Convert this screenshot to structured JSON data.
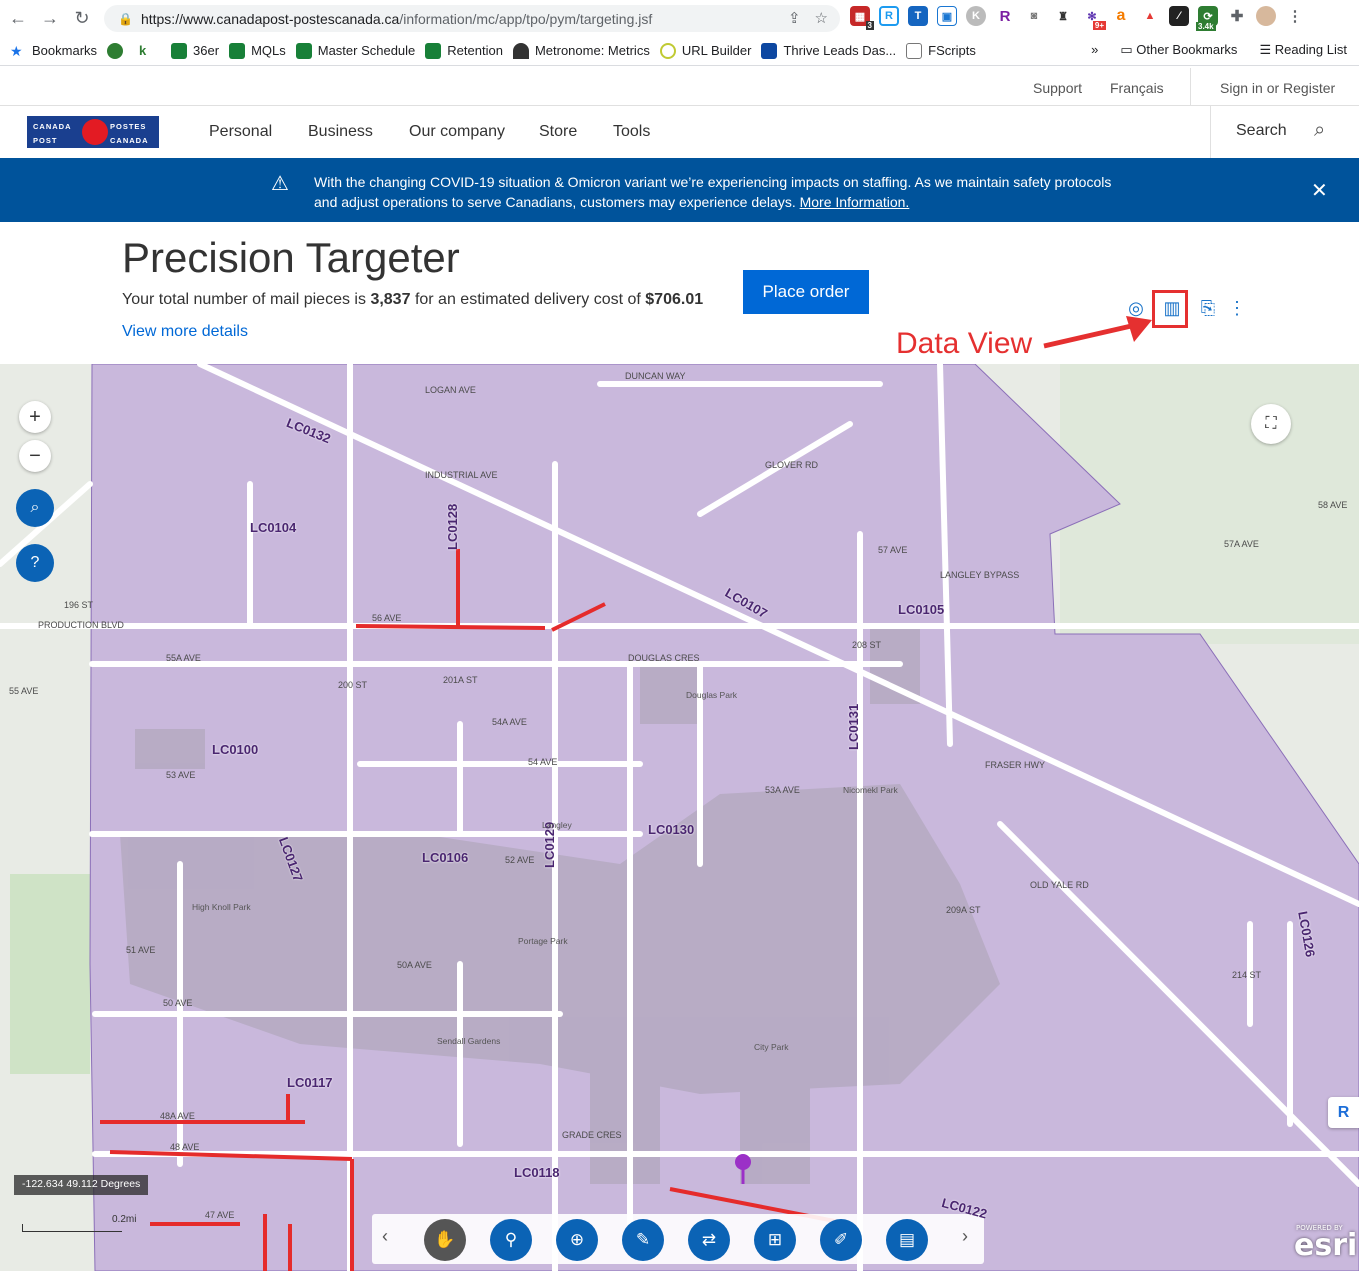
{
  "browser": {
    "url_host": "https://www.canadapost-postescanada.ca",
    "url_path": "/information/mc/app/tpo/pym/targeting.jsf",
    "bookmarks": [
      "Bookmarks",
      "36er",
      "MQLs",
      "Master Schedule",
      "Retention",
      "Metronome: Metrics",
      "URL Builder",
      "Thrive Leads Das...",
      "FScripts"
    ],
    "other_bookmarks": "Other Bookmarks",
    "reading_list": "Reading List",
    "ext_badges": [
      "3",
      "9+",
      "3.4k"
    ]
  },
  "header": {
    "utility": {
      "support": "Support",
      "language": "Français",
      "signin": "Sign in or Register"
    },
    "logo": {
      "l1": "CANADA",
      "l2": "POSTES",
      "l3": "POST",
      "l4": "CANADA"
    },
    "nav": [
      "Personal",
      "Business",
      "Our company",
      "Store",
      "Tools"
    ],
    "search_label": "Search"
  },
  "alert": {
    "message": "With the changing COVID-19 situation & Omicron variant we’re experiencing impacts on staffing. As we maintain safety protocols and adjust operations to serve Canadians, customers may experience delays.",
    "link": "More Information."
  },
  "page": {
    "title": "Precision Targeter",
    "summary_pre": "Your total number of mail pieces is",
    "mail_pieces": "3,837",
    "summary_mid": "for an estimated delivery cost of",
    "cost": "$706.01",
    "place_order": "Place order",
    "view_more": "View more details",
    "annotation": "Data View"
  },
  "map": {
    "coordinates": "-122.634 49.112 Degrees",
    "scale": "0.2mi",
    "attribution": "esri",
    "attribution_small": "POWERED BY",
    "accent": "#0b63b5",
    "fill": "#c9b8dc",
    "route_labels": [
      "LC0132",
      "LC0104",
      "LC0128",
      "LC0107",
      "LC0105",
      "LC0100",
      "LC0131",
      "LC0130",
      "LC0127",
      "LC0106",
      "LC0129",
      "LC0117",
      "LC0118",
      "LC0122",
      "LC0126"
    ],
    "street_labels": [
      "56 AVE",
      "55A AVE",
      "55 AVE",
      "54A AVE",
      "54 AVE",
      "53A AVE",
      "53 AVE",
      "52 AVE",
      "51 AVE",
      "50A AVE",
      "50 AVE",
      "48 AVE",
      "48A AVE",
      "FRASER HWY",
      "LANGLEY BYPASS",
      "DOUGLAS CRES",
      "GLOVER RD",
      "OLD YALE RD",
      "INDUSTRIAL AVE",
      "LOGAN AVE",
      "DUNCAN WAY",
      "57 AVE",
      "58 AVE",
      "57A AVE",
      "196 ST",
      "200 ST",
      "201A ST",
      "208 ST",
      "209A ST",
      "214 ST",
      "47 AVE",
      "GRADE CRES",
      "PRODUCTION BLVD"
    ],
    "place_labels": [
      "Douglas Park",
      "Nicomekl Park",
      "Langley",
      "High Knoll Park",
      "Portage Park",
      "Sendall Gardens",
      "City Park"
    ]
  }
}
